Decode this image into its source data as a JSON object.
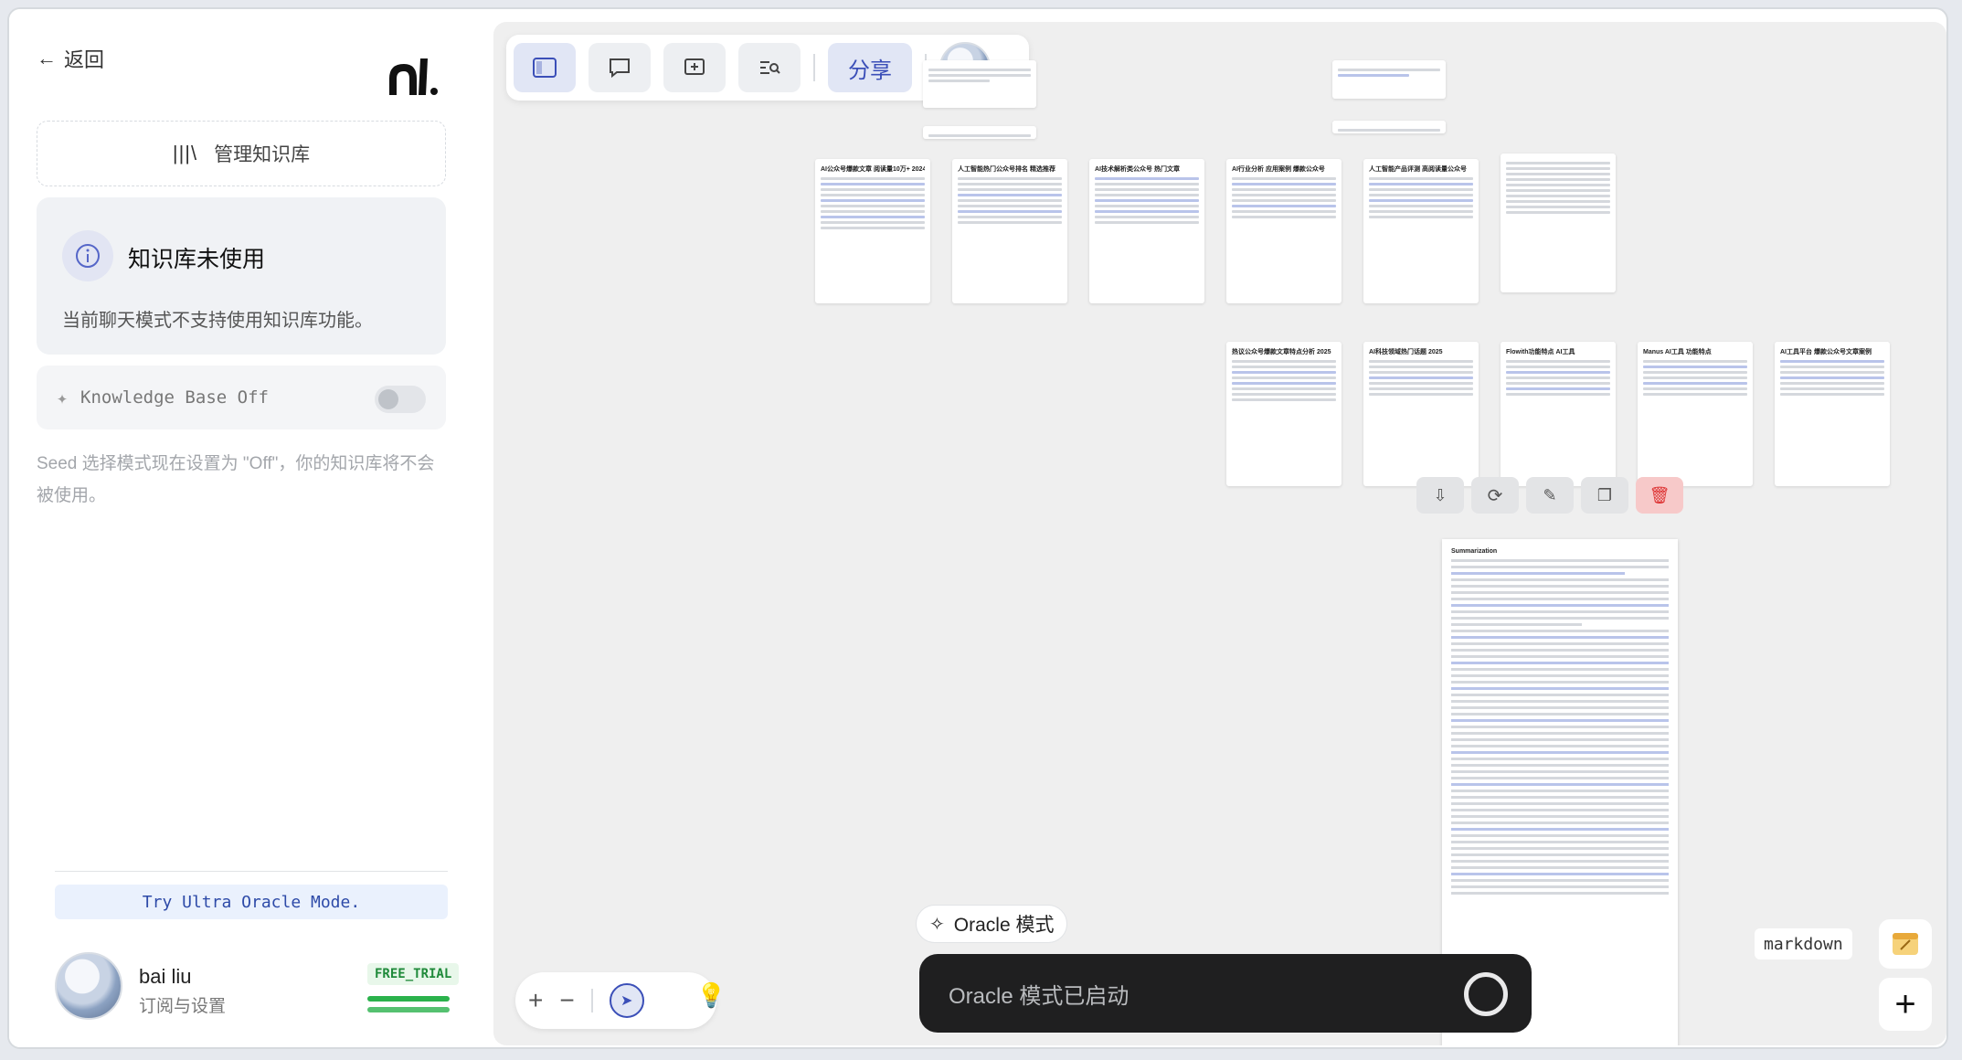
{
  "sidebar": {
    "back_label": "返回",
    "manage_kb_label": "管理知识库",
    "kb_card": {
      "title": "知识库未使用",
      "description": "当前聊天模式不支持使用知识库功能。"
    },
    "kb_toggle_label": "Knowledge Base Off",
    "seed_note": "Seed 选择模式现在设置为 \"Off\"，你的知识库将不会被使用。",
    "ultra_label": "Try Ultra Oracle Mode.",
    "user": {
      "name": "bai liu",
      "subtitle": "订阅与设置",
      "badge": "FREE_TRIAL"
    }
  },
  "toolbar": {
    "share_label": "分享"
  },
  "canvas": {
    "summary_title": "Summarization",
    "cards": [
      {
        "title": "AI公众号爆款文章 阅读量10万+ 2024"
      },
      {
        "title": "人工智能热门公众号排名 精选推荐"
      },
      {
        "title": "AI技术解析类公众号 热门文章"
      },
      {
        "title": "AI行业分析 应用案例 爆款公众号"
      },
      {
        "title": "人工智能产品评测 高阅读量公众号"
      },
      {
        "title": "热议公众号爆款文章特点分析 2025"
      },
      {
        "title": "AI科技领域热门话题 2025"
      },
      {
        "title": "Flowith功能特点 AI工具"
      },
      {
        "title": "Manus AI工具 功能特点"
      },
      {
        "title": "AI工具平台 爆款公众号文章案例"
      }
    ]
  },
  "oracle": {
    "chip_label": "Oracle 模式",
    "status": "Oracle 模式已启动"
  },
  "markdown_label": "markdown"
}
